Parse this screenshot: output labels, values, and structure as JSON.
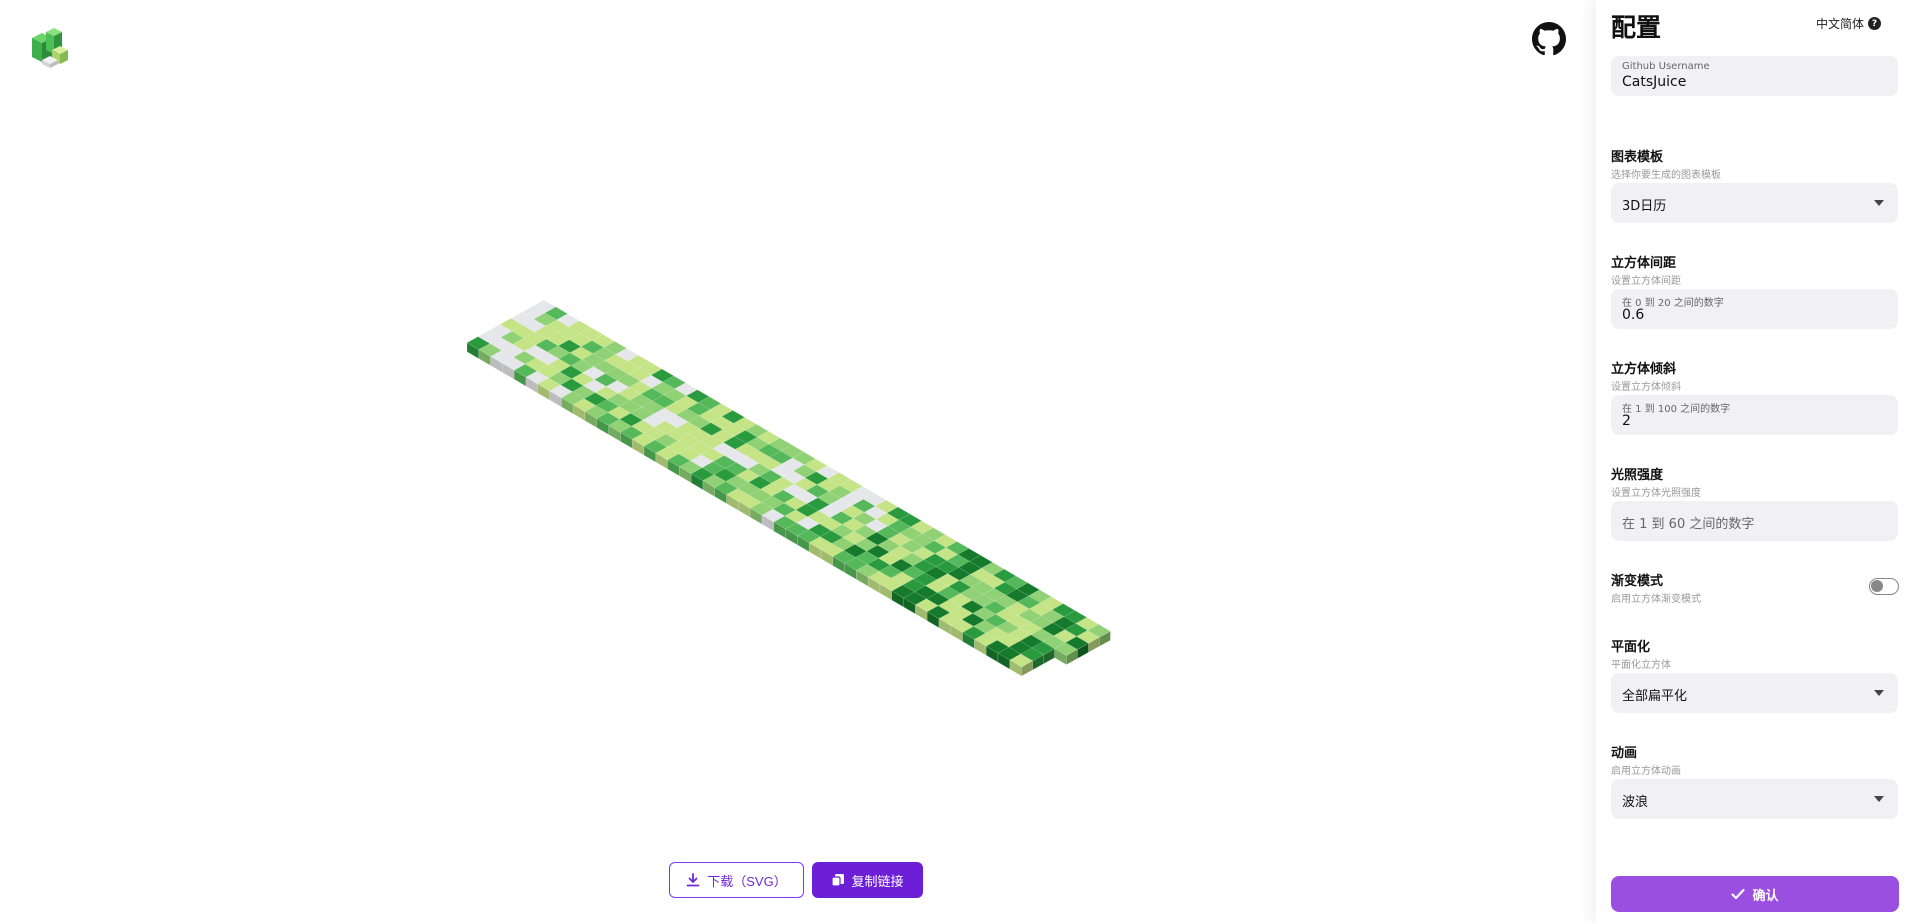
{
  "header": {
    "logo_icon": "cubes-logo-icon",
    "github_icon": "github-icon"
  },
  "actions": {
    "download_label": "下载（SVG）",
    "copy_label": "复制链接"
  },
  "panel": {
    "title": "配置",
    "language": "中文简体",
    "username": {
      "label": "Github Username",
      "value": "CatsJuice"
    },
    "template": {
      "label": "图表模板",
      "description": "选择你要生成的图表模板",
      "selected": "3D日历"
    },
    "gap": {
      "label": "立方体间距",
      "description": "设置立方体间距",
      "hint": "在 0 到 20 之间的数字",
      "value": "0.6"
    },
    "tilt": {
      "label": "立方体倾斜",
      "description": "设置立方体倾斜",
      "hint": "在 1 到 100 之间的数字",
      "value": "2"
    },
    "light": {
      "label": "光照强度",
      "description": "设置立方体光照强度",
      "placeholder": "在 1 到 60 之间的数字"
    },
    "gradient": {
      "label": "渐变模式",
      "description": "启用立方体渐变模式",
      "enabled": false
    },
    "flatten": {
      "label": "平面化",
      "description": "平面化立方体",
      "selected": "全部扁平化"
    },
    "animation": {
      "label": "动画",
      "description": "启用立方体动画",
      "selected": "波浪"
    },
    "confirm_label": "确认"
  },
  "colors": {
    "accent": "#6d1fd8",
    "confirm": "#9a4fe0",
    "levels": [
      "#e6e7ea",
      "#c4e486",
      "#8fd174",
      "#55b85a",
      "#2a9a3f",
      "#167a2c"
    ]
  }
}
